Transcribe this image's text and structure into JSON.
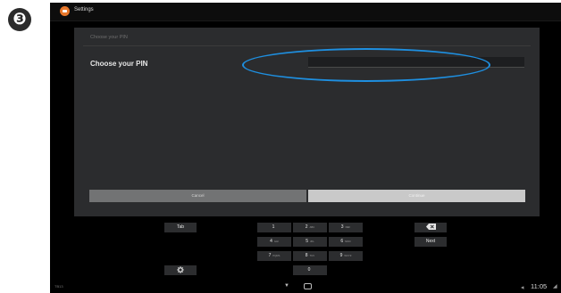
{
  "step_number": "❸",
  "action_bar": {
    "title": "Settings",
    "icon": "settings-app-icon"
  },
  "dialog": {
    "header": "Choose your PIN",
    "label": "Choose your PIN",
    "pin_value": "",
    "cancel_label": "Cancel",
    "continue_label": "Continue"
  },
  "highlight_color": "#1e8fe0",
  "keypad": {
    "tab": "Tab",
    "next": "Next",
    "settings_icon": "gear-icon",
    "backspace_icon": "backspace-icon",
    "keys": [
      {
        "digit": "1",
        "letters": ""
      },
      {
        "digit": "2",
        "letters": "ABC"
      },
      {
        "digit": "3",
        "letters": "DEF"
      },
      {
        "digit": "4",
        "letters": "GHI"
      },
      {
        "digit": "5",
        "letters": "JKL"
      },
      {
        "digit": "6",
        "letters": "MNO"
      },
      {
        "digit": "7",
        "letters": "PQRS"
      },
      {
        "digit": "8",
        "letters": "TUV"
      },
      {
        "digit": "9",
        "letters": "WXYZ"
      },
      {
        "digit": "0",
        "letters": ""
      }
    ]
  },
  "nav_bar": {
    "left_text": "TB13",
    "back_icon": "nav-back-down-icon",
    "home_icon": "nav-home-icon",
    "volume_icon": "volume-icon",
    "clock": "11:05",
    "signal_icon": "signal-icon"
  }
}
